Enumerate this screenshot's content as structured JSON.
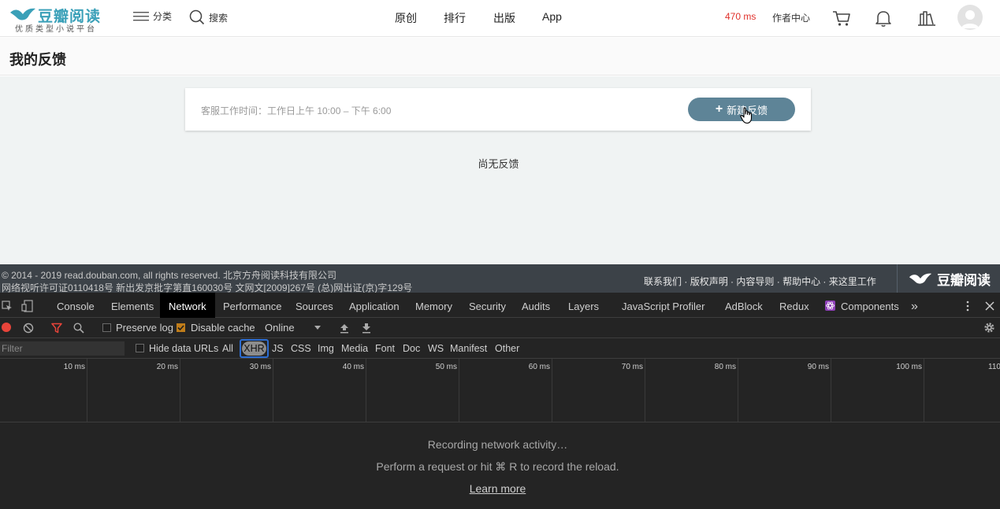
{
  "header": {
    "logo_title": "豆瓣阅读",
    "logo_subtitle": "优质类型小说平台",
    "category_label": "分类",
    "search_label": "搜索",
    "nav": [
      "原创",
      "排行",
      "出版",
      "App"
    ],
    "latency": "470 ms",
    "author_center": "作者中心"
  },
  "page": {
    "title": "我的反馈"
  },
  "feedback": {
    "service_hours": "客服工作时间：工作日上午 10:00 – 下午 6:00",
    "new_button": "新建反馈",
    "empty_text": "尚无反馈"
  },
  "footer": {
    "copyright": "© 2014 - 2019 read.douban.com, all rights reserved.  北京方舟阅读科技有限公司",
    "licenses": "网络视听许可证0110418号  新出发京批字第直160030号  文网文[2009]267号  (总)网出证(京)字129号",
    "links": [
      "联系我们",
      "版权声明",
      "内容导则",
      "帮助中心",
      "来这里工作"
    ],
    "logo_text": "豆瓣阅读"
  },
  "devtools": {
    "tabs": [
      "Console",
      "Elements",
      "Network",
      "Performance",
      "Sources",
      "Application",
      "Memory",
      "Security",
      "Audits",
      "Layers",
      "JavaScript Profiler",
      "AdBlock",
      "Redux",
      "Components"
    ],
    "active_tab": "Network",
    "more_tabs": "»",
    "toolbar": {
      "preserve_log": "Preserve log",
      "disable_cache": "Disable cache",
      "throttling": "Online"
    },
    "filter": {
      "placeholder": "Filter",
      "hide_data_urls": "Hide data URLs",
      "types": [
        "All",
        "XHR",
        "JS",
        "CSS",
        "Img",
        "Media",
        "Font",
        "Doc",
        "WS",
        "Manifest",
        "Other"
      ],
      "selected_type": "XHR"
    },
    "timeline_ticks": [
      "10 ms",
      "20 ms",
      "30 ms",
      "40 ms",
      "50 ms",
      "60 ms",
      "70 ms",
      "80 ms",
      "90 ms",
      "100 ms",
      "110"
    ],
    "recording_title": "Recording network activity…",
    "recording_hint": "Perform a request or hit ⌘ R to record the reload.",
    "learn_more": "Learn more",
    "colors": {
      "record": "#e8443a",
      "selected_outline": "#2d6dd1"
    }
  }
}
